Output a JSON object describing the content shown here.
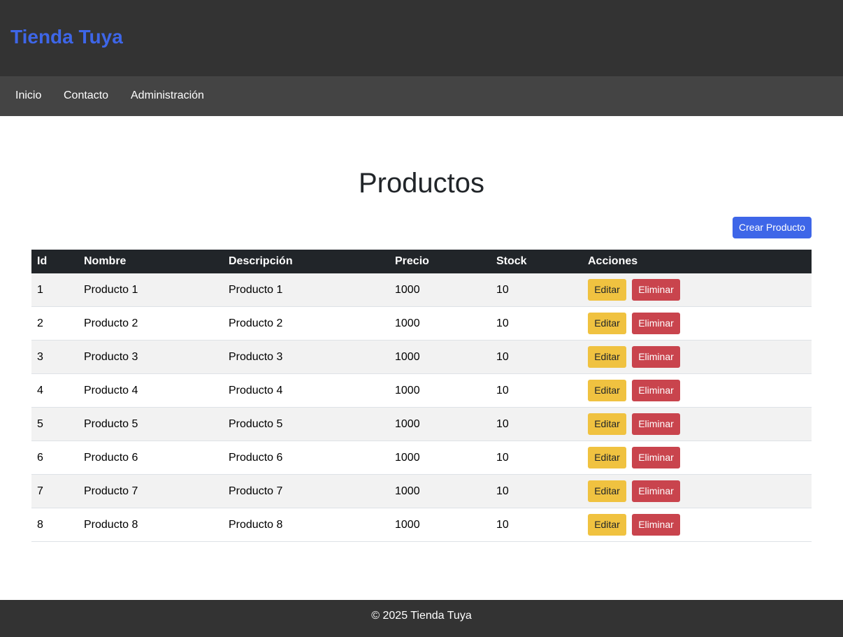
{
  "header": {
    "brand": "Tienda Tuya"
  },
  "nav": {
    "items": [
      {
        "label": "Inicio"
      },
      {
        "label": "Contacto"
      },
      {
        "label": "Administración"
      }
    ]
  },
  "main": {
    "title": "Productos",
    "create_button": "Crear Producto"
  },
  "table": {
    "columns": [
      "Id",
      "Nombre",
      "Descripción",
      "Precio",
      "Stock",
      "Acciones"
    ],
    "rows": [
      {
        "id": "1",
        "nombre": "Producto 1",
        "descripcion": "Producto 1",
        "precio": "1000",
        "stock": "10"
      },
      {
        "id": "2",
        "nombre": "Producto 2",
        "descripcion": "Producto 2",
        "precio": "1000",
        "stock": "10"
      },
      {
        "id": "3",
        "nombre": "Producto 3",
        "descripcion": "Producto 3",
        "precio": "1000",
        "stock": "10"
      },
      {
        "id": "4",
        "nombre": "Producto 4",
        "descripcion": "Producto 4",
        "precio": "1000",
        "stock": "10"
      },
      {
        "id": "5",
        "nombre": "Producto 5",
        "descripcion": "Producto 5",
        "precio": "1000",
        "stock": "10"
      },
      {
        "id": "6",
        "nombre": "Producto 6",
        "descripcion": "Producto 6",
        "precio": "1000",
        "stock": "10"
      },
      {
        "id": "7",
        "nombre": "Producto 7",
        "descripcion": "Producto 7",
        "precio": "1000",
        "stock": "10"
      },
      {
        "id": "8",
        "nombre": "Producto 8",
        "descripcion": "Producto 8",
        "precio": "1000",
        "stock": "10"
      }
    ],
    "edit_label": "Editar",
    "delete_label": "Eliminar"
  },
  "footer": {
    "text": "© 2025 Tienda Tuya"
  },
  "colors": {
    "brand": "#3e66e8",
    "header_bg": "#333333",
    "nav_bg": "#444444",
    "table_head_bg": "#212529",
    "edit_button": "#f0c240",
    "delete_button": "#c9444d",
    "primary_button": "#3e66e8"
  }
}
